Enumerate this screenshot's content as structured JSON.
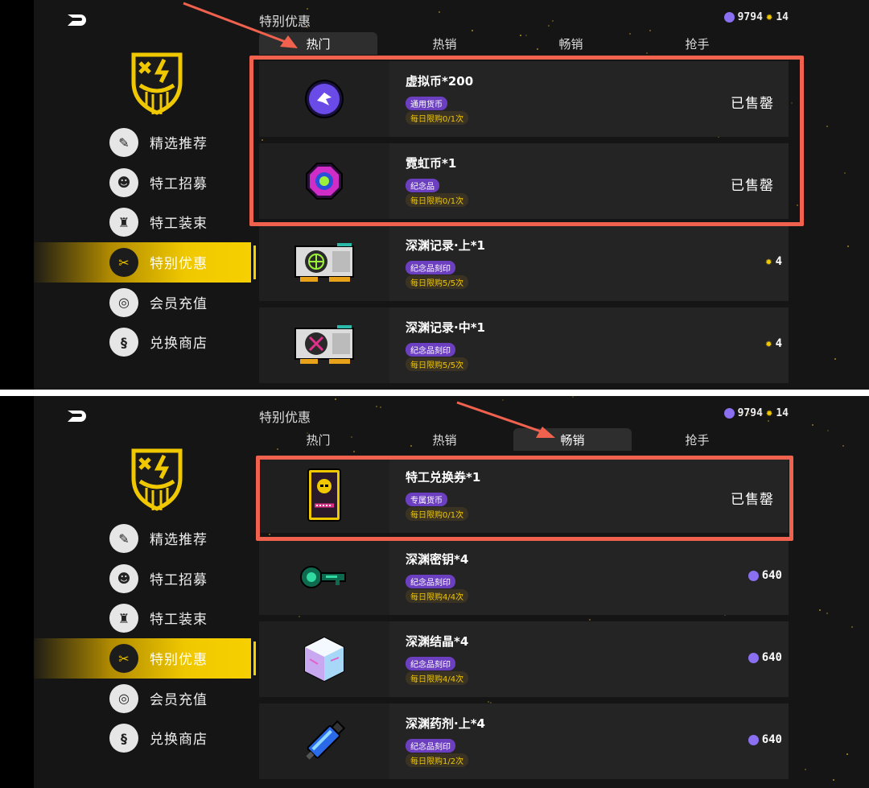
{
  "colors": {
    "accent": "#f0c800",
    "highlight": "#f0624e",
    "tag_purple": "#6b3fbf"
  },
  "panels": [
    {
      "title": "特别优惠",
      "currency": {
        "coin": "9794",
        "gear": "14"
      },
      "tabs": [
        "热门",
        "热销",
        "畅销",
        "抢手"
      ],
      "active_tab": 0,
      "sidebar": [
        {
          "label": "精选推荐",
          "icon": "featured-icon"
        },
        {
          "label": "特工招募",
          "icon": "recruit-icon"
        },
        {
          "label": "特工装束",
          "icon": "outfit-icon"
        },
        {
          "label": "特别优惠",
          "icon": "special-offer-icon"
        },
        {
          "label": "会员充值",
          "icon": "membership-icon"
        },
        {
          "label": "兑换商店",
          "icon": "exchange-icon"
        }
      ],
      "active_side": 3,
      "items": [
        {
          "name": "虚拟币*200",
          "tag": "通用货币",
          "limit": "每日限购0/1次",
          "status": "已售罄",
          "price": ""
        },
        {
          "name": "霓虹币*1",
          "tag": "纪念品",
          "limit": "每日限购0/1次",
          "status": "已售罄",
          "price": ""
        },
        {
          "name": "深渊记录·上*1",
          "tag": "纪念品刻印",
          "limit": "每日限购5/5次",
          "status": "",
          "price": "4"
        },
        {
          "name": "深渊记录·中*1",
          "tag": "纪念品刻印",
          "limit": "每日限购5/5次",
          "status": "",
          "price": "4"
        }
      ]
    },
    {
      "title": "特别优惠",
      "currency": {
        "coin": "9794",
        "gear": "14"
      },
      "tabs": [
        "热门",
        "热销",
        "畅销",
        "抢手"
      ],
      "active_tab": 2,
      "sidebar": [
        {
          "label": "精选推荐",
          "icon": "featured-icon"
        },
        {
          "label": "特工招募",
          "icon": "recruit-icon"
        },
        {
          "label": "特工装束",
          "icon": "outfit-icon"
        },
        {
          "label": "特别优惠",
          "icon": "special-offer-icon"
        },
        {
          "label": "会员充值",
          "icon": "membership-icon"
        },
        {
          "label": "兑换商店",
          "icon": "exchange-icon"
        }
      ],
      "active_side": 3,
      "items": [
        {
          "name": "特工兑换券*1",
          "tag": "专属货币",
          "limit": "每日限购0/1次",
          "status": "已售罄",
          "price": ""
        },
        {
          "name": "深渊密钥*4",
          "tag": "纪念品刻印",
          "limit": "每日限购4/4次",
          "status": "",
          "price": "640"
        },
        {
          "name": "深渊结晶*4",
          "tag": "纪念品刻印",
          "limit": "每日限购4/4次",
          "status": "",
          "price": "640"
        },
        {
          "name": "深渊药剂·上*4",
          "tag": "纪念品刻印",
          "limit": "每日限购1/2次",
          "status": "",
          "price": "640"
        }
      ]
    }
  ]
}
